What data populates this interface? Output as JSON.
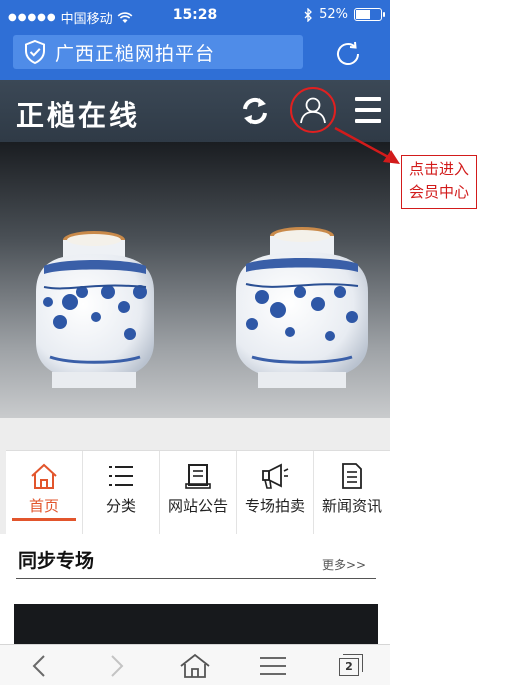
{
  "status_bar": {
    "carrier": "中国移动",
    "time": "15:28",
    "battery_text": "52%",
    "battery_level": 0.52
  },
  "browser": {
    "url_text": "广西正槌网拍平台",
    "shield_icon": "shield-check-icon",
    "reload_icon": "reload-icon"
  },
  "site_header": {
    "logo_text": "正槌在线",
    "refresh_icon": "refresh-icon",
    "user_icon": "user-icon",
    "menu_icon": "hamburger-menu-icon"
  },
  "banner": {
    "description_icons": [
      "blue-white-porcelain-jar",
      "blue-white-porcelain-jar"
    ]
  },
  "nav": {
    "tabs": [
      {
        "label": "首页",
        "icon": "home-icon",
        "active": true
      },
      {
        "label": "分类",
        "icon": "list-icon",
        "active": false
      },
      {
        "label": "网站公告",
        "icon": "notice-icon",
        "active": false
      },
      {
        "label": "专场拍卖",
        "icon": "megaphone-icon",
        "active": false
      },
      {
        "label": "新闻资讯",
        "icon": "document-icon",
        "active": false
      }
    ]
  },
  "section": {
    "title": "同步专场",
    "more": "更多>>"
  },
  "toolbar": {
    "tab_count": "2",
    "icons": [
      "back-icon",
      "forward-icon",
      "home-icon",
      "menu-icon",
      "tabs-icon"
    ]
  },
  "annotation": {
    "line1": "点击进入",
    "line2": "会员中心",
    "color": "#d21b1b"
  },
  "colors": {
    "browser_blue": "#2f6fd6",
    "header_dark": "#333f4b",
    "active_tab": "#e2552c"
  }
}
